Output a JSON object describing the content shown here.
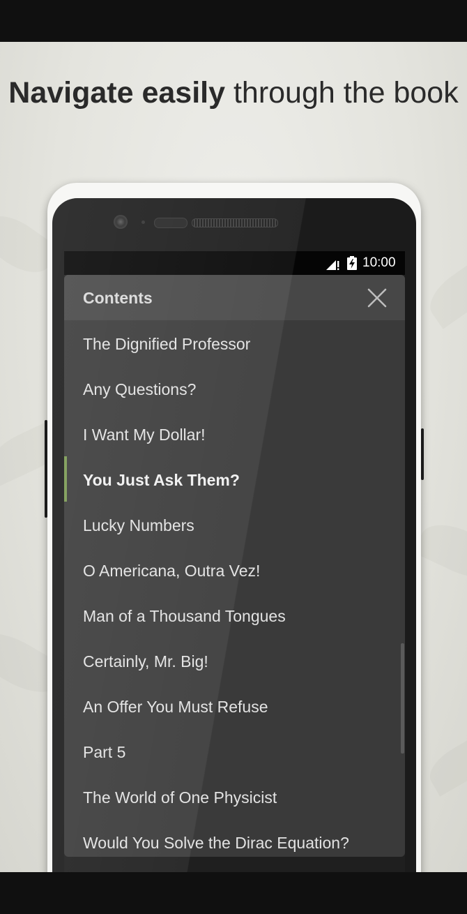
{
  "promo": {
    "headline_bold": "Navigate easily",
    "headline_rest": " through the book"
  },
  "status_bar": {
    "time": "10:00",
    "signal_icon": "signal-no-data-icon",
    "battery_icon": "battery-charging-icon"
  },
  "contents_panel": {
    "title": "Contents",
    "close_icon": "close-icon",
    "items": [
      {
        "label": "The Dignified Professor",
        "current": false
      },
      {
        "label": "Any Questions?",
        "current": false
      },
      {
        "label": "I Want My Dollar!",
        "current": false
      },
      {
        "label": "You Just Ask Them?",
        "current": true
      },
      {
        "label": "Lucky Numbers",
        "current": false
      },
      {
        "label": "O Americana, Outra Vez!",
        "current": false
      },
      {
        "label": "Man of a Thousand Tongues",
        "current": false
      },
      {
        "label": "Certainly, Mr. Big!",
        "current": false
      },
      {
        "label": "An Offer You Must Refuse",
        "current": false
      },
      {
        "label": "Part 5",
        "current": false
      },
      {
        "label": "The World of One Physicist",
        "current": false
      },
      {
        "label": "Would You Solve the Dirac Equation?",
        "current": false
      }
    ]
  },
  "colors": {
    "current_marker": "#7a9a52",
    "panel_background": "#3a3a3a",
    "header_background": "#474747"
  }
}
